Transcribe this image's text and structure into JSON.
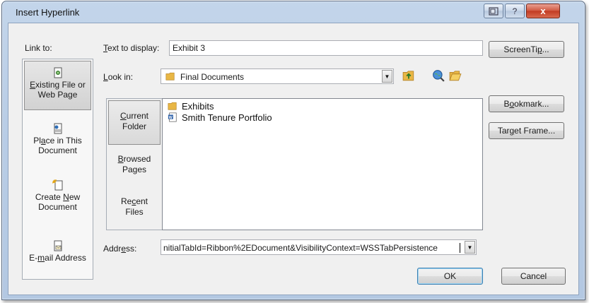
{
  "window": {
    "title": "Insert Hyperlink",
    "close_glyph": "x",
    "help_glyph": "?"
  },
  "link_to": {
    "label": "Link to:",
    "items": [
      {
        "label_a": "E",
        "label_b": "xisting File or",
        "label_line2": "Web Page",
        "icon": "existing-file-icon",
        "selected": true
      },
      {
        "label_a": "Pl",
        "label_b": "a",
        "label_c": "ce in This",
        "label_line2": "Document",
        "icon": "place-in-document-icon"
      },
      {
        "label_a": "Create ",
        "label_b": "N",
        "label_c": "ew",
        "label_line2": "Document",
        "icon": "new-document-icon"
      },
      {
        "label_a": "E-",
        "label_b": "m",
        "label_c": "ail Address",
        "icon": "email-icon"
      }
    ]
  },
  "text_to_display": {
    "label_a": "T",
    "label_b": "ext to display:",
    "value": "Exhibit 3"
  },
  "look_in": {
    "label_a": "L",
    "label_b": "ook in:",
    "value": "Final Documents"
  },
  "browse_tabs": [
    {
      "line1_a": "C",
      "line1_b": "urrent",
      "line2": "Folder",
      "selected": true
    },
    {
      "line1_a": "B",
      "line1_b": "rowsed",
      "line2": "Pages"
    },
    {
      "line1_a": "Re",
      "line1_b": "c",
      "line1_c": "ent",
      "line2": "Files"
    }
  ],
  "files": [
    {
      "name": "Exhibits",
      "icon": "folder-icon"
    },
    {
      "name": "Smith Tenure Portfolio",
      "icon": "word-document-icon"
    }
  ],
  "address": {
    "label_a": "Addr",
    "label_b": "e",
    "label_c": "ss:",
    "value": "nitialTabId=Ribbon%2EDocument&VisibilityContext=WSSTabPersistence"
  },
  "buttons": {
    "screentip_a": "ScreenTi",
    "screentip_b": "p",
    "screentip_c": "...",
    "bookmark_a": "B",
    "bookmark_b": "o",
    "bookmark_c": "okmark...",
    "target_frame_a": "Tar",
    "target_frame_b": "g",
    "target_frame_c": "et Frame...",
    "ok": "OK",
    "cancel": "Cancel"
  },
  "colors": {
    "frame": "#b9cde6",
    "client": "#f0f0f0",
    "close_red": "#c13a22"
  }
}
